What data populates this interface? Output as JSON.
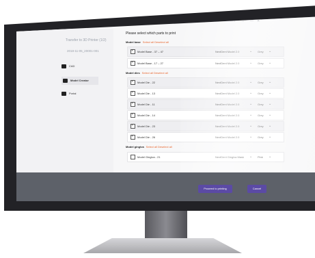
{
  "sidebar": {
    "title": "Transfer to 3D Printer (1/2)",
    "date": "2018-11-05_20001-001",
    "items": [
      {
        "label": "CAD",
        "icon": "tooth-icon",
        "active": false
      },
      {
        "label": "Model Creator",
        "icon": "model-icon",
        "active": true
      },
      {
        "label": "Portal",
        "icon": "portal-icon",
        "active": false
      }
    ]
  },
  "window_controls": [
    "?",
    "□",
    "—",
    "✕"
  ],
  "main": {
    "title": "Please select which parts to print",
    "sections": [
      {
        "heading": "Model base",
        "links": "Select all  Deselect all",
        "rows": [
          {
            "name": "Model Base - 37 – 47",
            "machine": "NextDent Model 2.0",
            "color": "Grey",
            "checked": true
          },
          {
            "name": "Model Base - 17 – 27",
            "machine": "NextDent Model 2.0",
            "color": "Grey",
            "checked": true
          }
        ]
      },
      {
        "heading": "Model dies",
        "links": "Select all  Deselect all",
        "rows": [
          {
            "name": "Model Die - 22",
            "machine": "NextDent Model 2.0",
            "color": "Grey",
            "checked": true
          },
          {
            "name": "Model Die - 13",
            "machine": "NextDent Model 2.0",
            "color": "Grey",
            "checked": true
          },
          {
            "name": "Model Die - 11",
            "machine": "NextDent Model 2.0",
            "color": "Grey",
            "checked": true
          },
          {
            "name": "Model Die - 14",
            "machine": "NextDent Model 2.0",
            "color": "Grey",
            "checked": true
          },
          {
            "name": "Model Die - 23",
            "machine": "NextDent Model 2.0",
            "color": "Grey",
            "checked": true
          },
          {
            "name": "Model Die - 26",
            "machine": "NextDent Model 2.0",
            "color": "Grey",
            "checked": true
          }
        ]
      },
      {
        "heading": "Model gingiva",
        "links": "Select all  Deselect all",
        "rows": [
          {
            "name": "Model Gingiva - 21",
            "machine": "NextDent Gingiva Mask",
            "color": "Pink",
            "checked": false
          }
        ]
      }
    ]
  },
  "footer": {
    "proceed_label": "Proceed to printing",
    "cancel_label": "Cancel"
  },
  "colors": {
    "accent": "#5b4aa5",
    "link": "#e8662e",
    "footer": "#5d6169"
  }
}
